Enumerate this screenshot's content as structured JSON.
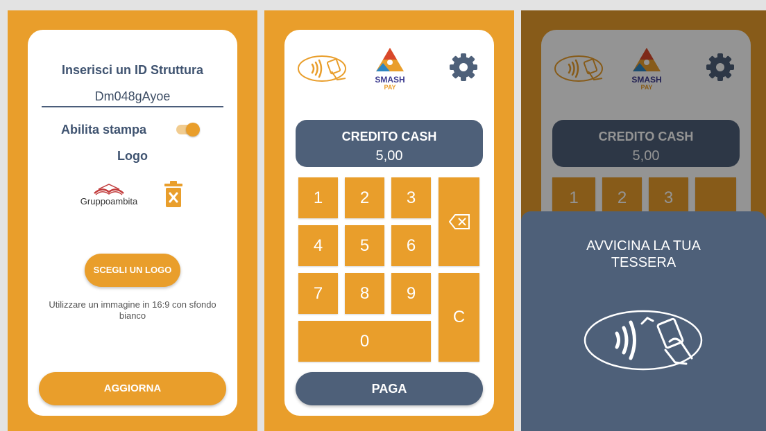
{
  "settings": {
    "id_title": "Inserisci un ID Struttura",
    "id_value": "Dm048gAyoe",
    "print_label": "Abilita stampa",
    "print_enabled": true,
    "logo_title": "Logo",
    "logo_brand": "Gruppoambita",
    "pick_logo_label": "SCEGLI UN LOGO",
    "hint": "Utilizzare un immagine in 16:9 con sfondo bianco",
    "update_label": "AGGIORNA"
  },
  "pos": {
    "brand_name": "SMASH",
    "brand_sub": "PAY",
    "credit_label": "CREDITO CASH",
    "credit_value": "5,00",
    "keys": [
      "1",
      "2",
      "3",
      "4",
      "5",
      "6",
      "7",
      "8",
      "9",
      "0"
    ],
    "clear_key": "C",
    "pay_label": "PAGA"
  },
  "nfc_sheet": {
    "line1": "AVVICINA LA TUA",
    "line2": "TESSERA"
  },
  "colors": {
    "accent": "#e99e2b",
    "slate": "#4e6079",
    "background": "#e3e3e3"
  }
}
